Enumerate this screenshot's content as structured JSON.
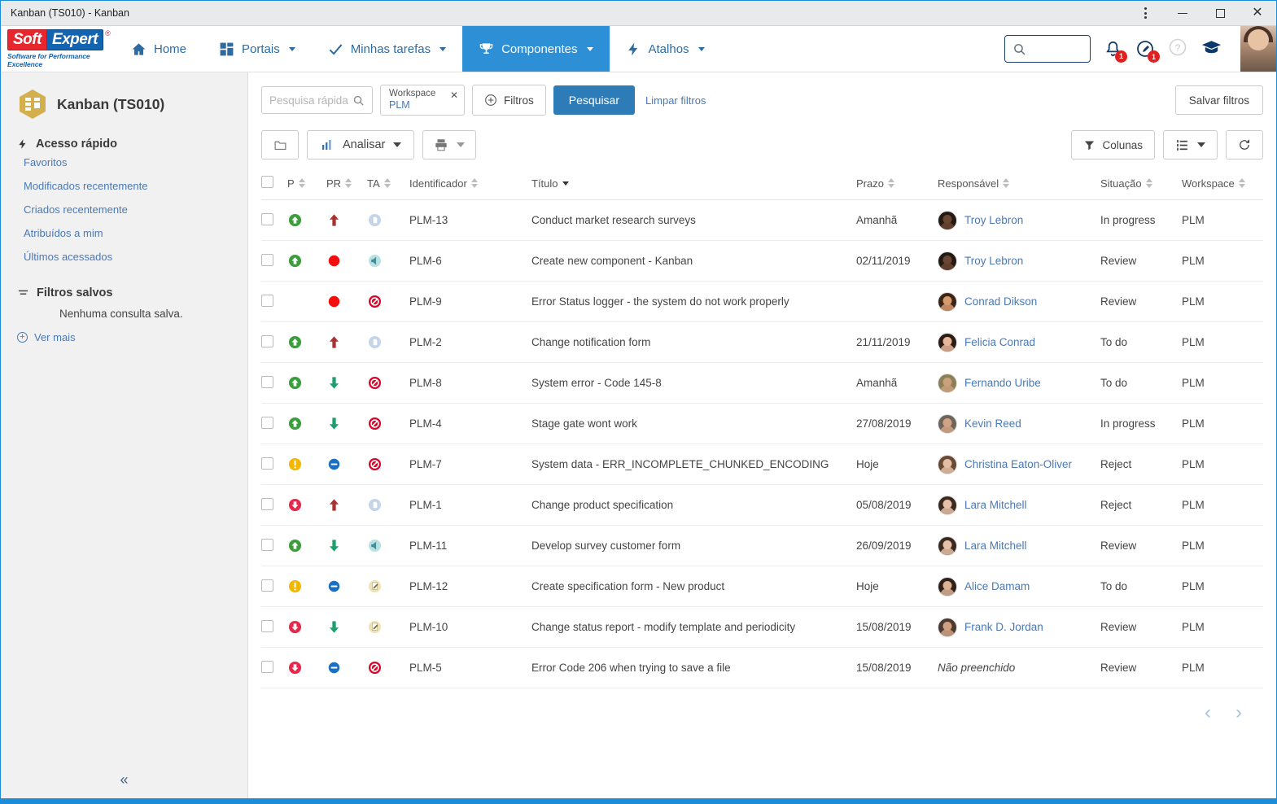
{
  "window": {
    "title": "Kanban (TS010) - Kanban",
    "controls": {
      "menu": "⋮",
      "minimize": "—",
      "maximize": "□",
      "close": "✕"
    }
  },
  "brand": {
    "soft": "Soft",
    "expert": "Expert",
    "registered": "®",
    "tagline": "Software for Performance Excellence",
    "red": "#e8262d",
    "blue": "#1263b0"
  },
  "nav": {
    "items": [
      {
        "label": "Home",
        "icon": "home-icon",
        "caret": false,
        "active": false
      },
      {
        "label": "Portais",
        "icon": "grid-icon",
        "caret": true,
        "active": false
      },
      {
        "label": "Minhas tarefas",
        "icon": "check-icon",
        "caret": true,
        "active": false
      },
      {
        "label": "Componentes",
        "icon": "trophy-icon",
        "caret": true,
        "active": true
      },
      {
        "label": "Atalhos",
        "icon": "bolt-icon",
        "caret": true,
        "active": false
      }
    ],
    "search_value": "",
    "notifications_badge": "1",
    "messages_badge": "1",
    "accent": "#2d8fd5"
  },
  "sidebar": {
    "title": "Kanban (TS010)",
    "quick_access_title": "Acesso rápido",
    "quick_links": [
      "Favoritos",
      "Modificados recentemente",
      "Criados recentemente",
      "Atribuídos a mim",
      "Últimos acessados"
    ],
    "saved_filters_title": "Filtros salvos",
    "saved_filters_empty": "Nenhuma consulta salva.",
    "see_more": "Ver mais",
    "collapse_icon": "«"
  },
  "filterbar": {
    "quick_search_placeholder": "Pesquisa rápida",
    "quick_search_value": "",
    "chip": {
      "label": "Workspace",
      "value": "PLM",
      "remove": "✕"
    },
    "filters_button": "Filtros",
    "search_button": "Pesquisar",
    "clear_filters": "Limpar filtros",
    "save_filters": "Salvar filtros"
  },
  "actionbar": {
    "folder_button": "",
    "analyze_button": "Analisar",
    "print_button": "",
    "columns_button": "Colunas",
    "view_button": "",
    "refresh_button": ""
  },
  "table": {
    "columns": [
      {
        "key": "checkbox",
        "label": "",
        "sorted": false
      },
      {
        "key": "p",
        "label": "P",
        "sorted": false
      },
      {
        "key": "pr",
        "label": "PR",
        "sorted": false
      },
      {
        "key": "ta",
        "label": "TA",
        "sorted": false
      },
      {
        "key": "identificador",
        "label": "Identificador",
        "sorted": false
      },
      {
        "key": "titulo",
        "label": "Título",
        "sorted": true
      },
      {
        "key": "prazo",
        "label": "Prazo",
        "sorted": false
      },
      {
        "key": "responsavel",
        "label": "Responsável",
        "sorted": false
      },
      {
        "key": "situacao",
        "label": "Situação",
        "sorted": false
      },
      {
        "key": "workspace",
        "label": "Workspace",
        "sorted": false
      }
    ],
    "rows": [
      {
        "p": "green-up",
        "pr": "arrow-up-red",
        "ta": "doc-blue",
        "id": "PLM-13",
        "title": "Conduct market research surveys",
        "prazo": "Amanhã",
        "responsavel": "Troy Lebron",
        "avatar": "troy",
        "situacao": "In progress",
        "workspace": "PLM"
      },
      {
        "p": "green-up",
        "pr": "circle-red",
        "ta": "bell-teal",
        "id": "PLM-6",
        "title": "Create new component - Kanban",
        "prazo": "02/11/2019",
        "responsavel": "Troy Lebron",
        "avatar": "troy",
        "situacao": "Review",
        "workspace": "PLM"
      },
      {
        "p": "none",
        "pr": "circle-red",
        "ta": "blocked-red",
        "id": "PLM-9",
        "title": "Error Status logger - the system do not work properly",
        "prazo": "",
        "responsavel": "Conrad Dikson",
        "avatar": "conrad",
        "situacao": "Review",
        "workspace": "PLM"
      },
      {
        "p": "green-up",
        "pr": "arrow-up-red",
        "ta": "doc-blue",
        "id": "PLM-2",
        "title": "Change notification form",
        "prazo": "21/11/2019",
        "responsavel": "Felicia Conrad",
        "avatar": "felicia",
        "situacao": "To do",
        "workspace": "PLM"
      },
      {
        "p": "green-up",
        "pr": "arrow-down-green",
        "ta": "blocked-red",
        "id": "PLM-8",
        "title": "System error - Code 145-8",
        "prazo": "Amanhã",
        "responsavel": "Fernando Uribe",
        "avatar": "fernando",
        "situacao": "To do",
        "workspace": "PLM"
      },
      {
        "p": "green-up",
        "pr": "arrow-down-green",
        "ta": "blocked-red",
        "id": "PLM-4",
        "title": "Stage gate wont work",
        "prazo": "27/08/2019",
        "responsavel": "Kevin Reed",
        "avatar": "kevin",
        "situacao": "In progress",
        "workspace": "PLM"
      },
      {
        "p": "yellow-warning",
        "pr": "minus-blue",
        "ta": "blocked-red",
        "id": "PLM-7",
        "title": "System data - ERR_INCOMPLETE_CHUNKED_ENCODING",
        "prazo": "Hoje",
        "responsavel": "Christina Eaton-Oliver",
        "avatar": "christina",
        "situacao": "Reject",
        "workspace": "PLM"
      },
      {
        "p": "red-down",
        "pr": "arrow-up-red",
        "ta": "doc-blue",
        "id": "PLM-1",
        "title": "Change product specification",
        "prazo": "05/08/2019",
        "responsavel": "Lara Mitchell",
        "avatar": "lara",
        "situacao": "Reject",
        "workspace": "PLM"
      },
      {
        "p": "green-up",
        "pr": "arrow-down-green",
        "ta": "bell-teal",
        "id": "PLM-11",
        "title": "Develop survey customer form",
        "prazo": "26/09/2019",
        "responsavel": "Lara Mitchell",
        "avatar": "lara",
        "situacao": "Review",
        "workspace": "PLM"
      },
      {
        "p": "yellow-warning",
        "pr": "minus-blue",
        "ta": "clipboard-yellow",
        "id": "PLM-12",
        "title": "Create specification form - New product",
        "prazo": "Hoje",
        "responsavel": "Alice Damam",
        "avatar": "alice",
        "situacao": "To do",
        "workspace": "PLM"
      },
      {
        "p": "red-down",
        "pr": "arrow-down-green",
        "ta": "clipboard-yellow",
        "id": "PLM-10",
        "title": "Change status report - modify template and periodicity",
        "prazo": "15/08/2019",
        "responsavel": "Frank D. Jordan",
        "avatar": "frank",
        "situacao": "Review",
        "workspace": "PLM"
      },
      {
        "p": "red-down",
        "pr": "minus-blue",
        "ta": "blocked-red",
        "id": "PLM-5",
        "title": "Error Code 206 when trying to save a file",
        "prazo": "15/08/2019",
        "responsavel": "Não preenchido",
        "avatar": "none",
        "situacao": "Review",
        "workspace": "PLM"
      }
    ]
  },
  "pagination": {
    "prev": "‹",
    "next": "›"
  }
}
